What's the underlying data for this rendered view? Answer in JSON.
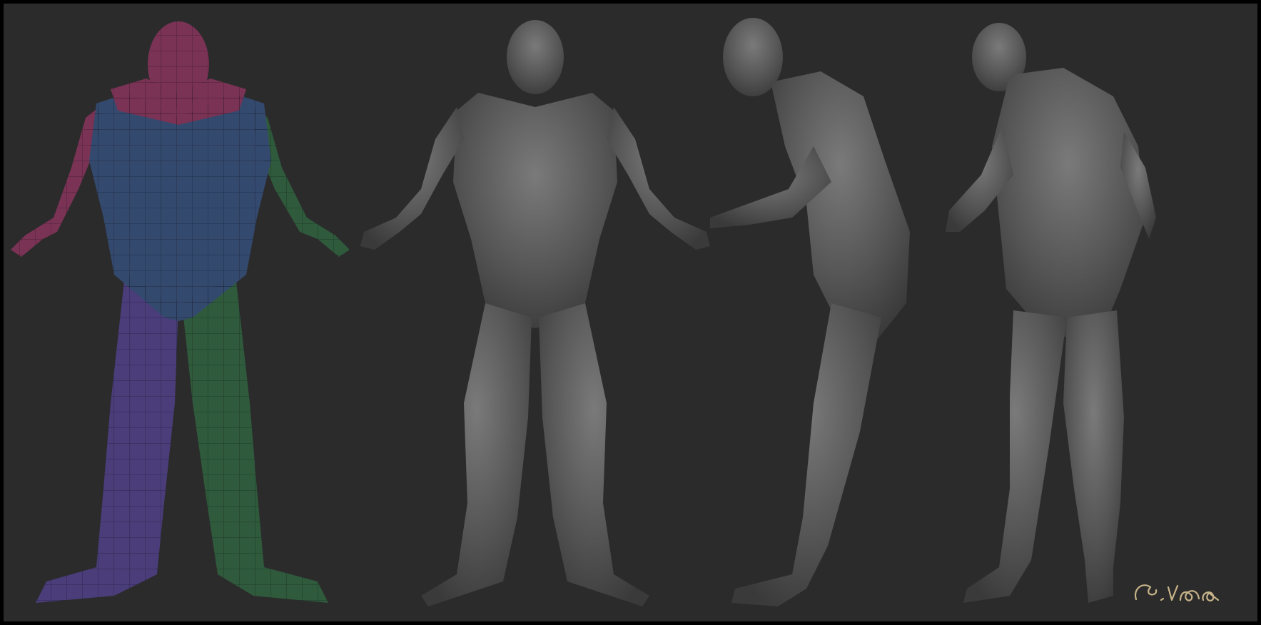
{
  "scene": {
    "background_color": "#2b2b2b",
    "border_color": "#000000",
    "figures": [
      {
        "view": "front-basemesh",
        "segment_colors": {
          "head": "#7a3355",
          "torso": "#34496e",
          "left_arm": "#7a3355",
          "right_arm": "#2f5a3c",
          "left_leg": "#4a3d7a",
          "right_leg": "#2f5a3c"
        }
      },
      {
        "view": "front-sculpt",
        "color": "#5a5a5a"
      },
      {
        "view": "side-sculpt",
        "color": "#5a5a5a"
      },
      {
        "view": "back-sculpt",
        "color": "#5a5a5a"
      }
    ],
    "signature": {
      "text": "G.Vida",
      "color": "#c8b48a"
    }
  }
}
